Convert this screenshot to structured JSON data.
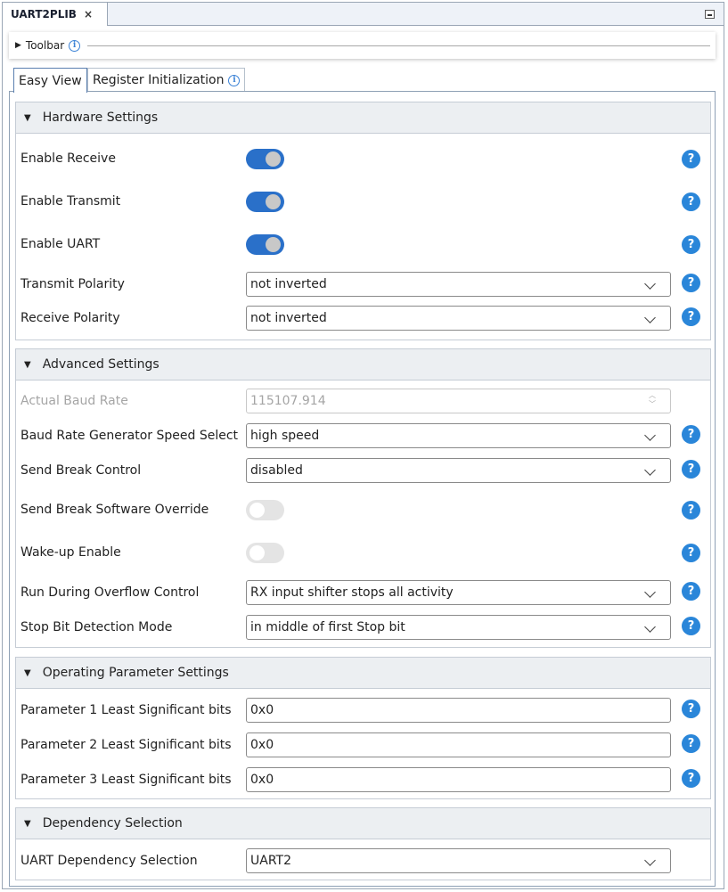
{
  "window": {
    "tab_title": "UART2PLIB",
    "close_glyph": "×"
  },
  "toolbar": {
    "label": "Toolbar",
    "info_glyph": "i"
  },
  "view_tabs": [
    {
      "label": "Easy View",
      "active": true
    },
    {
      "label": "Register Initialization",
      "active": false,
      "info_glyph": "i"
    }
  ],
  "help_glyph": "?",
  "sections": {
    "hardware": {
      "title": "Hardware Settings",
      "enable_receive": {
        "label": "Enable Receive",
        "on": true
      },
      "enable_transmit": {
        "label": "Enable Transmit",
        "on": true
      },
      "enable_uart": {
        "label": "Enable UART",
        "on": true
      },
      "transmit_polarity": {
        "label": "Transmit Polarity",
        "value": "not inverted"
      },
      "receive_polarity": {
        "label": "Receive Polarity",
        "value": "not inverted"
      }
    },
    "advanced": {
      "title": "Advanced Settings",
      "actual_baud_rate": {
        "label": "Actual Baud Rate",
        "value": "115107.914"
      },
      "brg_speed": {
        "label": "Baud Rate Generator Speed Select",
        "value": "high speed"
      },
      "send_break_control": {
        "label": "Send Break Control",
        "value": "disabled"
      },
      "send_break_override": {
        "label": "Send Break Software Override",
        "on": false
      },
      "wakeup_enable": {
        "label": "Wake-up Enable",
        "on": false
      },
      "run_during_overflow": {
        "label": "Run During Overflow Control",
        "value": "RX input shifter stops all activity"
      },
      "stop_bit_detection": {
        "label": "Stop Bit Detection Mode",
        "value": "in middle of first Stop bit"
      }
    },
    "operating": {
      "title": "Operating Parameter Settings",
      "param1": {
        "label": "Parameter 1 Least Significant bits",
        "value": "0x0"
      },
      "param2": {
        "label": "Parameter 2 Least Significant bits",
        "value": "0x0"
      },
      "param3": {
        "label": "Parameter 3 Least Significant bits",
        "value": "0x0"
      }
    },
    "dependency": {
      "title": "Dependency Selection",
      "uart_dependency": {
        "label": "UART Dependency Selection",
        "value": "UART2"
      }
    }
  },
  "colors": {
    "toggle_on": "#2a70c9",
    "toggle_off": "#e4e4e4",
    "help_icon": "#2a86d9",
    "section_header_bg": "#eceff2"
  }
}
